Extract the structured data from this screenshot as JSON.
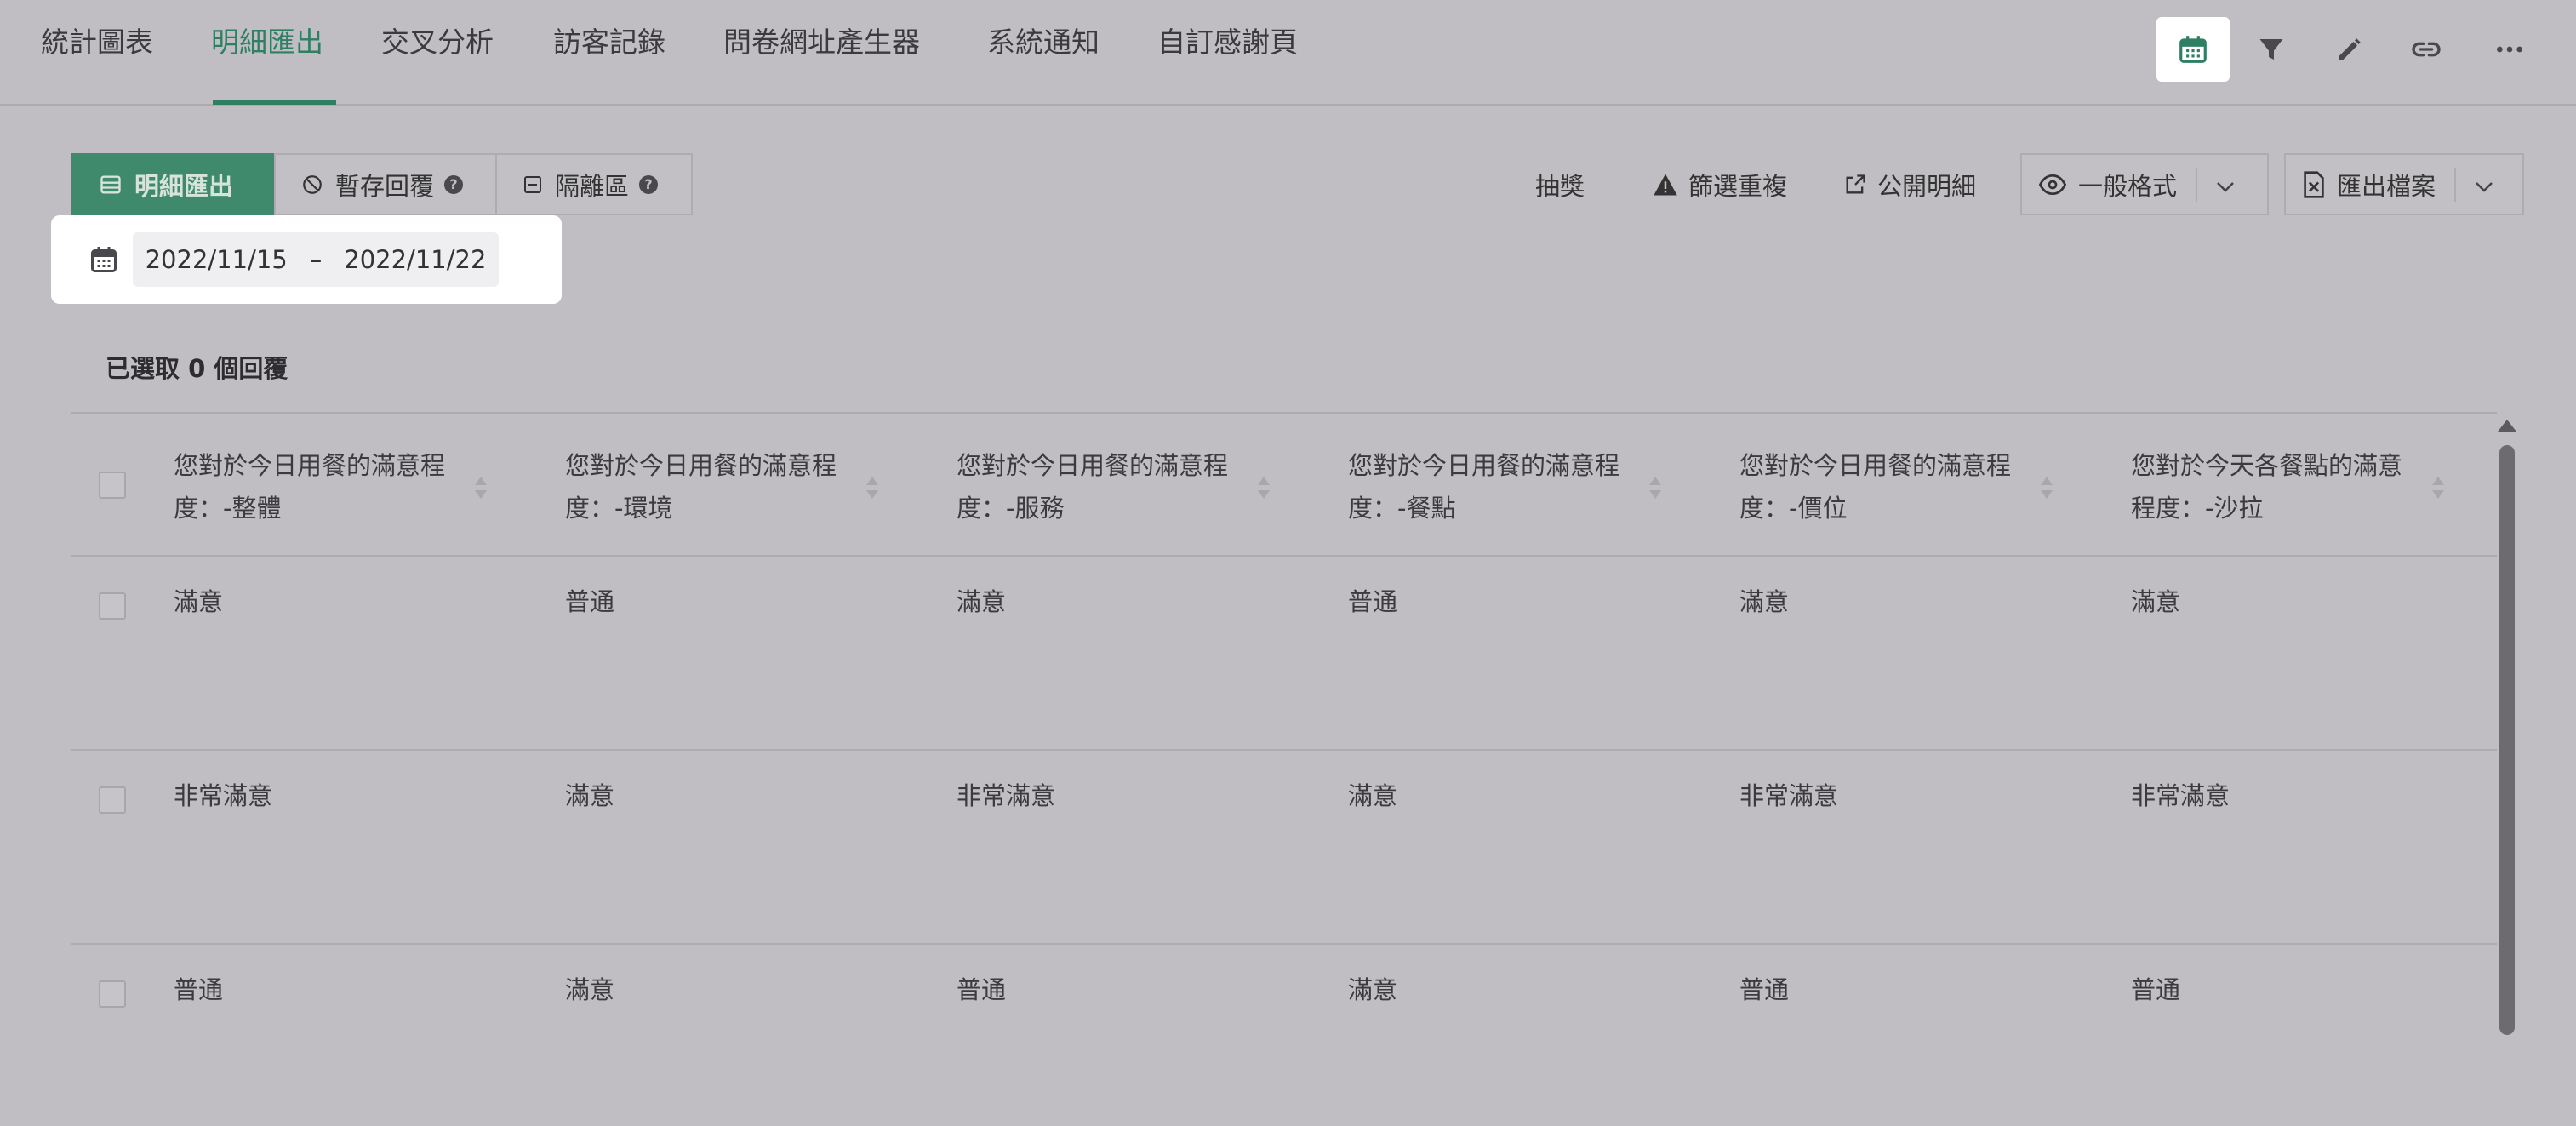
{
  "tabs": [
    {
      "label": "統計圖表",
      "active": false
    },
    {
      "label": "明細匯出",
      "active": true
    },
    {
      "label": "交叉分析",
      "active": false
    },
    {
      "label": "訪客記錄",
      "active": false
    },
    {
      "label": "問卷網址產生器",
      "active": false
    },
    {
      "label": "系統通知",
      "active": false
    },
    {
      "label": "自訂感謝頁",
      "active": false
    }
  ],
  "top_icons": [
    "calendar-icon",
    "filter-icon",
    "pencil-icon",
    "link-icon",
    "more-icon"
  ],
  "toolbar": {
    "detail_export": "明細匯出",
    "draft_replies": "暫存回覆",
    "quarantine": "隔離區",
    "lottery": "抽獎",
    "filter_duplicates": "篩選重複",
    "public_detail": "公開明細",
    "format": "一般格式",
    "export_file": "匯出檔案"
  },
  "date_range": {
    "start": "2022/11/15",
    "separator": "–",
    "end": "2022/11/22"
  },
  "selection": {
    "text": "已選取 0 個回覆"
  },
  "table": {
    "columns": [
      "您對於今日用餐的滿意程度：-整體",
      "您對於今日用餐的滿意程度：-環境",
      "您對於今日用餐的滿意程度：-服務",
      "您對於今日用餐的滿意程度：-餐點",
      "您對於今日用餐的滿意程度：-價位",
      "您對於今天各餐點的滿意程度：-沙拉"
    ],
    "rows": [
      [
        "滿意",
        "普通",
        "滿意",
        "普通",
        "滿意",
        "滿意"
      ],
      [
        "非常滿意",
        "滿意",
        "非常滿意",
        "滿意",
        "非常滿意",
        "非常滿意"
      ],
      [
        "普通",
        "滿意",
        "普通",
        "滿意",
        "普通",
        "普通"
      ]
    ]
  },
  "colors": {
    "accent": "#2f7f63",
    "primary_button": "#3f8a6c",
    "overlay_bg": "#c0bec2",
    "highlight": "#ffffff"
  }
}
